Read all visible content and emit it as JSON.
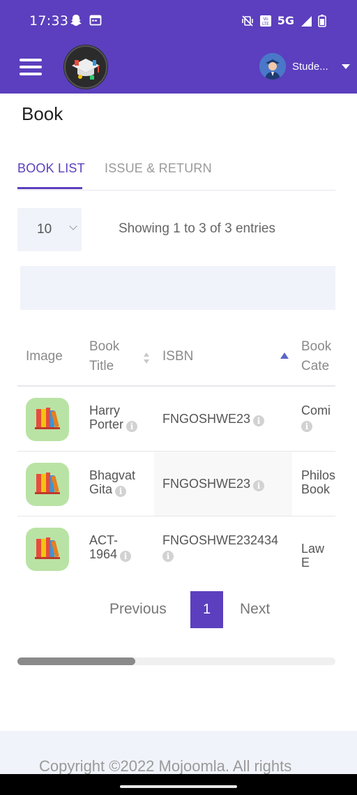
{
  "status_bar": {
    "time": "17:33",
    "network": "5G"
  },
  "header": {
    "user_name": "Stude..."
  },
  "page": {
    "title": "Book"
  },
  "tabs": [
    {
      "label": "BOOK LIST",
      "active": true
    },
    {
      "label": "ISSUE & RETURN",
      "active": false
    }
  ],
  "entries": {
    "selected": "10",
    "info": "Showing 1 to 3 of 3 entries"
  },
  "table": {
    "headers": {
      "image": "Image",
      "book_title_line1": "Book",
      "book_title_line2": "Title",
      "isbn": "ISBN",
      "category_line1": "Book",
      "category_line2": "Cate"
    },
    "rows": [
      {
        "title_line1": "Harry",
        "title_line2": "Porter",
        "isbn": "FNGOSHWE23",
        "category_line1": "Comi",
        "category_line2": ""
      },
      {
        "title_line1": "Bhagvat",
        "title_line2": "Gita",
        "isbn": "FNGOSHWE23",
        "category_line1": "Philos",
        "category_line2": "Book"
      },
      {
        "title_line1": "ACT-",
        "title_line2": "1964",
        "isbn": "FNGOSHWE232434",
        "category_line1": "Law E",
        "category_line2": ""
      }
    ],
    "info_icon_glyph": "i"
  },
  "pagination": {
    "previous": "Previous",
    "current": "1",
    "next": "Next"
  },
  "footer": {
    "text": "Copyright ©2022 Mojoomla. All rights"
  },
  "colors": {
    "primary": "#5b3fbe",
    "panel": "#f0f3f9",
    "thumb_bg": "#b9e3a4"
  }
}
